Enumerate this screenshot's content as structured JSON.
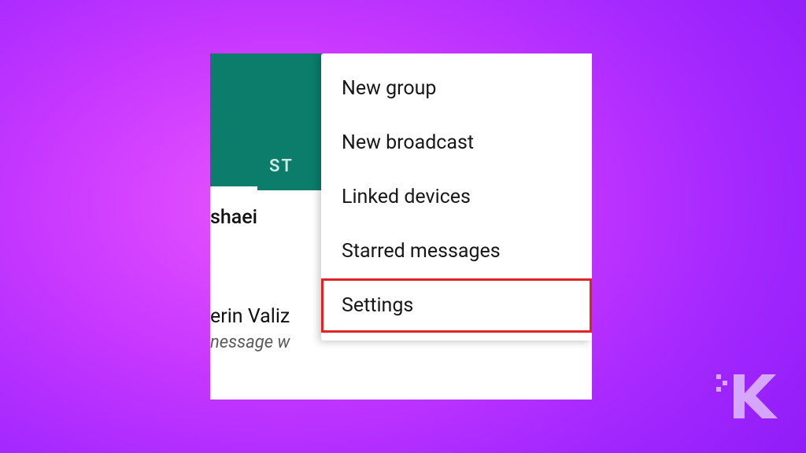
{
  "header": {
    "tab_fragment": "ST"
  },
  "chats": {
    "contact1_fragment": "shaei",
    "contact2_fragment": "erin Valiz",
    "preview_fragment": "nessage w"
  },
  "menu": {
    "items": [
      {
        "label": "New group",
        "highlighted": false
      },
      {
        "label": "New broadcast",
        "highlighted": false
      },
      {
        "label": "Linked devices",
        "highlighted": false
      },
      {
        "label": "Starred messages",
        "highlighted": false
      },
      {
        "label": "Settings",
        "highlighted": true
      }
    ]
  },
  "branding": {
    "logo_letter": "K"
  }
}
